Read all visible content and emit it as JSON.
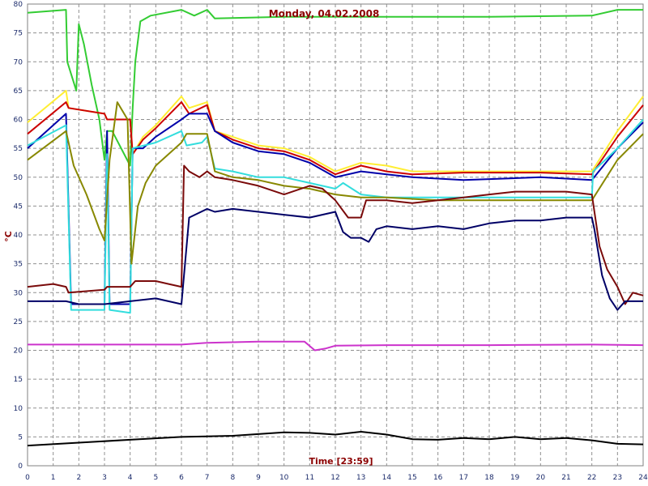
{
  "chart_data": {
    "type": "line",
    "title": "Monday, 04.02.2008",
    "xlabel": "Time [23:59]",
    "ylabel": "°C",
    "xlim": [
      0,
      24
    ],
    "ylim": [
      0,
      80
    ],
    "x_ticks": [
      "0",
      "1",
      "2",
      "3",
      "4",
      "5",
      "6",
      "7",
      "8",
      "9",
      "10",
      "11",
      "12",
      "13",
      "14",
      "15",
      "16",
      "17",
      "18",
      "19",
      "20",
      "21",
      "22",
      "23",
      "24"
    ],
    "y_ticks": [
      "0",
      "5",
      "10",
      "15",
      "20",
      "25",
      "30",
      "35",
      "40",
      "45",
      "50",
      "55",
      "60",
      "65",
      "70",
      "75",
      "80"
    ],
    "grid": true,
    "legend": "none",
    "series": [
      {
        "color": "#33cc33",
        "points": [
          [
            0,
            78.5
          ],
          [
            1.5,
            79
          ],
          [
            1.55,
            70
          ],
          [
            1.9,
            65
          ],
          [
            2.0,
            76.5
          ],
          [
            2.2,
            73
          ],
          [
            2.5,
            66
          ],
          [
            2.8,
            60
          ],
          [
            3.0,
            53
          ],
          [
            3.1,
            58
          ],
          [
            3.3,
            58
          ],
          [
            4.0,
            52
          ],
          [
            4.1,
            62
          ],
          [
            4.2,
            70
          ],
          [
            4.4,
            77
          ],
          [
            4.8,
            78
          ],
          [
            6.0,
            79
          ],
          [
            6.5,
            78
          ],
          [
            7.0,
            79
          ],
          [
            7.3,
            77.5
          ],
          [
            10,
            77.8
          ],
          [
            14,
            77.8
          ],
          [
            18,
            77.8
          ],
          [
            22,
            78
          ],
          [
            23,
            79
          ],
          [
            24,
            79
          ]
        ]
      },
      {
        "color": "#ffee33",
        "points": [
          [
            0,
            59.5
          ],
          [
            1.5,
            65
          ],
          [
            1.6,
            62
          ],
          [
            3.0,
            61
          ],
          [
            3.1,
            60
          ],
          [
            4.0,
            60
          ],
          [
            4.1,
            54
          ],
          [
            4.5,
            57
          ],
          [
            5,
            59
          ],
          [
            6,
            64
          ],
          [
            6.3,
            62
          ],
          [
            7,
            63
          ],
          [
            7.3,
            58
          ],
          [
            8,
            57
          ],
          [
            9,
            55.5
          ],
          [
            10,
            55
          ],
          [
            11,
            53.5
          ],
          [
            12,
            51
          ],
          [
            13,
            52.5
          ],
          [
            14,
            52
          ],
          [
            15,
            51
          ],
          [
            17,
            51
          ],
          [
            20,
            51
          ],
          [
            22,
            51
          ],
          [
            23,
            58
          ],
          [
            24,
            64
          ]
        ]
      },
      {
        "color": "#cc0000",
        "points": [
          [
            0,
            57.5
          ],
          [
            1.5,
            63
          ],
          [
            1.6,
            62
          ],
          [
            3.0,
            61
          ],
          [
            3.1,
            60
          ],
          [
            4.0,
            60
          ],
          [
            4.1,
            54
          ],
          [
            4.5,
            56.5
          ],
          [
            5,
            58.5
          ],
          [
            6,
            63
          ],
          [
            6.3,
            61
          ],
          [
            7,
            62.5
          ],
          [
            7.3,
            58
          ],
          [
            8,
            56.5
          ],
          [
            9,
            55
          ],
          [
            10,
            54.5
          ],
          [
            11,
            53
          ],
          [
            12,
            50.5
          ],
          [
            13,
            52
          ],
          [
            14,
            51
          ],
          [
            15,
            50.5
          ],
          [
            17,
            50.8
          ],
          [
            20,
            50.8
          ],
          [
            22,
            50.5
          ],
          [
            23,
            57
          ],
          [
            24,
            62.5
          ]
        ]
      },
      {
        "color": "#0000aa",
        "points": [
          [
            0,
            55
          ],
          [
            1.5,
            61
          ],
          [
            1.7,
            28
          ],
          [
            3.0,
            28
          ],
          [
            3.1,
            58
          ],
          [
            3.2,
            28
          ],
          [
            4.0,
            28
          ],
          [
            4.1,
            55
          ],
          [
            4.5,
            55
          ],
          [
            5,
            57
          ],
          [
            6,
            60
          ],
          [
            6.3,
            61
          ],
          [
            7,
            61
          ],
          [
            7.3,
            58
          ],
          [
            8,
            56
          ],
          [
            9,
            54.5
          ],
          [
            10,
            54
          ],
          [
            11,
            52.5
          ],
          [
            12,
            50
          ],
          [
            13,
            51
          ],
          [
            14,
            50.5
          ],
          [
            15,
            50
          ],
          [
            17,
            49.5
          ],
          [
            20,
            50
          ],
          [
            22,
            49.5
          ],
          [
            23,
            55
          ],
          [
            24,
            59.5
          ]
        ]
      },
      {
        "color": "#33dddd",
        "points": [
          [
            0,
            55.5
          ],
          [
            1.5,
            59
          ],
          [
            1.7,
            27
          ],
          [
            3.0,
            27
          ],
          [
            3.1,
            54
          ],
          [
            3.2,
            27
          ],
          [
            4.0,
            26.5
          ],
          [
            4.1,
            55
          ],
          [
            5,
            56
          ],
          [
            6,
            58
          ],
          [
            6.2,
            55.5
          ],
          [
            6.8,
            56
          ],
          [
            7,
            57
          ],
          [
            7.3,
            51.5
          ],
          [
            8,
            51
          ],
          [
            9,
            50
          ],
          [
            10,
            50
          ],
          [
            11,
            49
          ],
          [
            12,
            48
          ],
          [
            12.3,
            49
          ],
          [
            13,
            47
          ],
          [
            14,
            46.5
          ],
          [
            16,
            46.5
          ],
          [
            18,
            46.5
          ],
          [
            20,
            46.5
          ],
          [
            22,
            46.5
          ],
          [
            22.05,
            51
          ],
          [
            23,
            55
          ],
          [
            24,
            60
          ]
        ]
      },
      {
        "color": "#888800",
        "points": [
          [
            0,
            53
          ],
          [
            1.5,
            58
          ],
          [
            1.8,
            52
          ],
          [
            2.3,
            47
          ],
          [
            2.8,
            41
          ],
          [
            3.0,
            39
          ],
          [
            3.2,
            53
          ],
          [
            3.5,
            63
          ],
          [
            3.9,
            60
          ],
          [
            4.05,
            35
          ],
          [
            4.3,
            45
          ],
          [
            4.6,
            49
          ],
          [
            5,
            52
          ],
          [
            6,
            56
          ],
          [
            6.2,
            57.5
          ],
          [
            7,
            57.5
          ],
          [
            7.3,
            51
          ],
          [
            8,
            50
          ],
          [
            9,
            49.5
          ],
          [
            10,
            48.5
          ],
          [
            11,
            48
          ],
          [
            12,
            47
          ],
          [
            13,
            46.5
          ],
          [
            14,
            46.5
          ],
          [
            16,
            46
          ],
          [
            18,
            46
          ],
          [
            20,
            46
          ],
          [
            22,
            46
          ],
          [
            23,
            53
          ],
          [
            24,
            57.5
          ]
        ]
      },
      {
        "color": "#7a0a0a",
        "points": [
          [
            0,
            31
          ],
          [
            1,
            31.5
          ],
          [
            1.5,
            31
          ],
          [
            1.6,
            30
          ],
          [
            3.0,
            30.5
          ],
          [
            3.1,
            31
          ],
          [
            4.0,
            31
          ],
          [
            4.2,
            32
          ],
          [
            5,
            32
          ],
          [
            5.5,
            31.5
          ],
          [
            6.0,
            31
          ],
          [
            6.1,
            52
          ],
          [
            6.3,
            51
          ],
          [
            6.7,
            50
          ],
          [
            7,
            51
          ],
          [
            7.3,
            50
          ],
          [
            8,
            49.5
          ],
          [
            9,
            48.5
          ],
          [
            10,
            47
          ],
          [
            11,
            48.5
          ],
          [
            11.5,
            48
          ],
          [
            12,
            46
          ],
          [
            12.5,
            43
          ],
          [
            13,
            43
          ],
          [
            13.2,
            46
          ],
          [
            14,
            46
          ],
          [
            15,
            45.5
          ],
          [
            16,
            46
          ],
          [
            17,
            46.5
          ],
          [
            18,
            47
          ],
          [
            19,
            47.5
          ],
          [
            20,
            47.5
          ],
          [
            21,
            47.5
          ],
          [
            22,
            47
          ],
          [
            22.3,
            38
          ],
          [
            22.6,
            34
          ],
          [
            23,
            31
          ],
          [
            23.3,
            28
          ],
          [
            23.6,
            30
          ],
          [
            24,
            29.5
          ]
        ]
      },
      {
        "color": "#000066",
        "points": [
          [
            0,
            28.5
          ],
          [
            1.5,
            28.5
          ],
          [
            2,
            28
          ],
          [
            3,
            28
          ],
          [
            4,
            28.5
          ],
          [
            5,
            29
          ],
          [
            6,
            28
          ],
          [
            6.3,
            43
          ],
          [
            7,
            44.5
          ],
          [
            7.3,
            44
          ],
          [
            8,
            44.5
          ],
          [
            9,
            44
          ],
          [
            10,
            43.5
          ],
          [
            11,
            43
          ],
          [
            12,
            44
          ],
          [
            12.3,
            40.5
          ],
          [
            12.6,
            39.5
          ],
          [
            13,
            39.5
          ],
          [
            13.3,
            38.8
          ],
          [
            13.6,
            41
          ],
          [
            14,
            41.5
          ],
          [
            15,
            41
          ],
          [
            16,
            41.5
          ],
          [
            17,
            41
          ],
          [
            18,
            42
          ],
          [
            19,
            42.5
          ],
          [
            20,
            42.5
          ],
          [
            21,
            43
          ],
          [
            22,
            43
          ],
          [
            22.1,
            41
          ],
          [
            22.4,
            33
          ],
          [
            22.7,
            29
          ],
          [
            23,
            27
          ],
          [
            23.3,
            28.5
          ],
          [
            24,
            28.5
          ]
        ]
      },
      {
        "color": "#cc33cc",
        "points": [
          [
            0,
            21
          ],
          [
            3,
            21
          ],
          [
            6,
            21
          ],
          [
            7,
            21.3
          ],
          [
            9,
            21.5
          ],
          [
            10,
            21.5
          ],
          [
            10.8,
            21.5
          ],
          [
            11.2,
            20
          ],
          [
            11.6,
            20.3
          ],
          [
            12,
            20.8
          ],
          [
            14,
            20.9
          ],
          [
            18,
            20.9
          ],
          [
            22,
            21
          ],
          [
            24,
            20.9
          ]
        ]
      },
      {
        "color": "#000000",
        "points": [
          [
            0,
            3.5
          ],
          [
            2,
            4
          ],
          [
            4,
            4.5
          ],
          [
            6,
            5
          ],
          [
            8,
            5.2
          ],
          [
            10,
            5.8
          ],
          [
            11,
            5.7
          ],
          [
            12,
            5.4
          ],
          [
            13,
            5.9
          ],
          [
            14,
            5.4
          ],
          [
            15,
            4.6
          ],
          [
            16,
            4.5
          ],
          [
            17,
            4.8
          ],
          [
            18,
            4.6
          ],
          [
            19,
            5
          ],
          [
            20,
            4.6
          ],
          [
            21,
            4.8
          ],
          [
            22,
            4.4
          ],
          [
            23,
            3.8
          ],
          [
            24,
            3.7
          ]
        ]
      }
    ]
  }
}
